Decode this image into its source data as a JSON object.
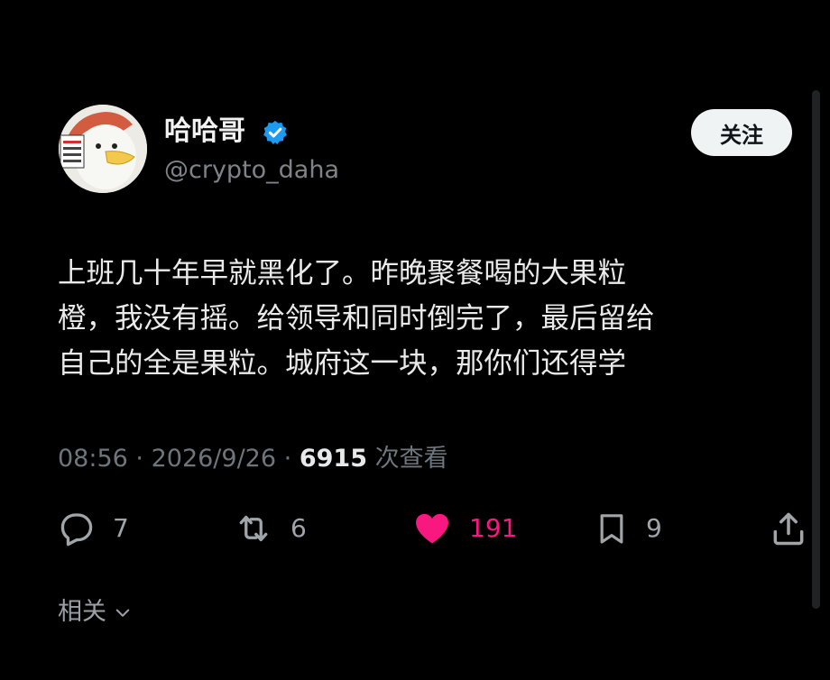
{
  "user": {
    "display_name": "哈哈哥",
    "handle": "@crypto_daha",
    "verified_color": "#1d9bf0"
  },
  "follow_button": {
    "label": "关注"
  },
  "tweet": {
    "lines": [
      "上班几十年早就黑化了。昨晚聚餐喝的大果粒",
      "橙，我没有摇。给领导和同时倒完了，最后留给",
      "自己的全是果粒。城府这一块，那你们还得学"
    ]
  },
  "meta": {
    "time": "08:56",
    "separator": "·",
    "date": "2026/9/26",
    "views_count": "6915",
    "views_label": "次查看"
  },
  "actions": {
    "reply": {
      "icon": "reply-icon",
      "count": "7"
    },
    "retweet": {
      "icon": "retweet-icon",
      "count": "6"
    },
    "like": {
      "icon": "heart-icon",
      "count": "191",
      "color": "#f91880"
    },
    "bookmark": {
      "icon": "bookmark-icon",
      "count": "9"
    },
    "share": {
      "icon": "share-icon"
    }
  },
  "related": {
    "label": "相关"
  }
}
